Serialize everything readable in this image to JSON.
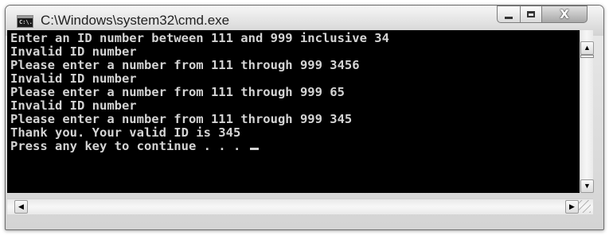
{
  "window": {
    "title": "C:\\Windows\\system32\\cmd.exe",
    "icon": "cmd-icon",
    "icon_text": "C:\\."
  },
  "controls": {
    "minimize_icon": "minimize-icon",
    "maximize_icon": "maximize-icon",
    "close_icon": "close-icon",
    "close_glyph": "X"
  },
  "console": {
    "lines": [
      "Enter an ID number between 111 and 999 inclusive 34",
      "Invalid ID number",
      "Please enter a number from 111 through 999 3456",
      "Invalid ID number",
      "Please enter a number from 111 through 999 65",
      "Invalid ID number",
      "Please enter a number from 111 through 999 345",
      "Thank you. Your valid ID is 345",
      "Press any key to continue . . . "
    ],
    "text_color": "#d4d4d4",
    "background_color": "#000000"
  },
  "scrollbars": {
    "up_arrow": "▲",
    "down_arrow": "▼",
    "left_arrow": "◀",
    "right_arrow": "▶"
  }
}
